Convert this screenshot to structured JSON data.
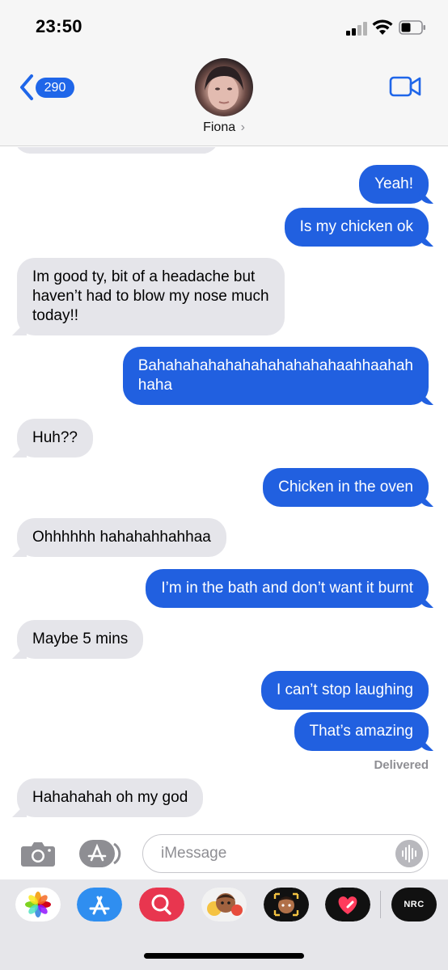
{
  "status_bar": {
    "time": "23:50"
  },
  "header": {
    "back_count": "290",
    "contact_name": "Fiona",
    "name_chevron": "›"
  },
  "messages": [
    {
      "text": "Yeah!",
      "direction": "sent"
    },
    {
      "text": "Is my chicken ok",
      "direction": "sent"
    },
    {
      "text": "Im good ty, bit of a headache but\nhaven’t had to blow my nose much\ntoday!!",
      "direction": "received"
    },
    {
      "text": "Bahahahahahahahahahahahaahhaahah\nhaha",
      "direction": "sent"
    },
    {
      "text": "Huh??",
      "direction": "received"
    },
    {
      "text": "Chicken in the oven",
      "direction": "sent"
    },
    {
      "text": "Ohhhhhh hahahahhahhaa",
      "direction": "received"
    },
    {
      "text": "I’m in the bath and don’t want it burnt",
      "direction": "sent"
    },
    {
      "text": "Maybe 5 mins",
      "direction": "received"
    },
    {
      "text": "I can’t stop laughing",
      "direction": "sent"
    },
    {
      "text": "That’s amazing",
      "direction": "sent"
    },
    {
      "text": "Hahahahah oh my god",
      "direction": "received"
    }
  ],
  "delivered_label": "Delivered",
  "composer": {
    "placeholder": "iMessage"
  },
  "app_drawer": {
    "apps": [
      "photos-icon",
      "app-store-icon",
      "search-images-icon",
      "memoji-stickers-icon",
      "memoji-icon",
      "digital-touch-icon",
      "nike-run-club-icon"
    ],
    "nrc_label": "NRC"
  },
  "colors": {
    "sent_bubble": "#2160e0",
    "received_bubble": "#e5e5ea",
    "accent": "#1f66e9"
  }
}
